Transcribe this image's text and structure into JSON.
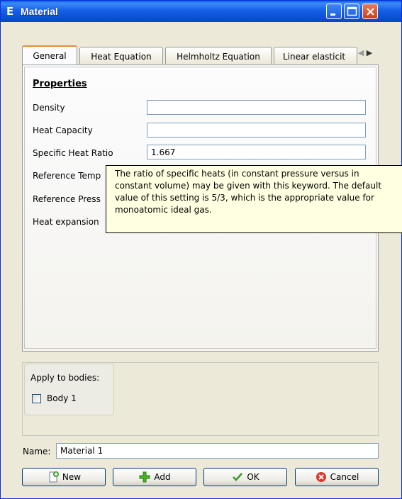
{
  "window": {
    "title": "Material",
    "app_icon_letter": "E"
  },
  "tabs": [
    {
      "label": "General",
      "active": true
    },
    {
      "label": "Heat Equation",
      "active": false
    },
    {
      "label": "Helmholtz Equation",
      "active": false
    },
    {
      "label": "Linear elasticit",
      "active": false
    }
  ],
  "general": {
    "section_title": "Properties",
    "rows": [
      {
        "label": "Density",
        "value": ""
      },
      {
        "label": "Heat Capacity",
        "value": ""
      },
      {
        "label": "Specific Heat Ratio",
        "value": "1.667"
      },
      {
        "label": "Reference Temp",
        "value": ""
      },
      {
        "label": "Reference Press",
        "value": ""
      },
      {
        "label": "Heat expansion",
        "value": ""
      }
    ]
  },
  "tooltip": {
    "lines": [
      "The ratio of specific heats (in constant pressure versus in",
      "constant volume) may be given with this keyword. The default",
      "value of this setting is 5/3, which is the appropriate value for",
      "monoatomic ideal gas."
    ]
  },
  "apply": {
    "label": "Apply to bodies:",
    "bodies": [
      {
        "label": "Body 1",
        "checked": false
      }
    ]
  },
  "name": {
    "label": "Name:",
    "value": "Material 1"
  },
  "buttons": {
    "new": "New",
    "add": "Add",
    "ok": "OK",
    "cancel": "Cancel"
  },
  "colors": {
    "titlebar": "#0a5fe4",
    "tooltip_bg": "#ffffe1",
    "active_tab_accent": "#e68b2c"
  }
}
